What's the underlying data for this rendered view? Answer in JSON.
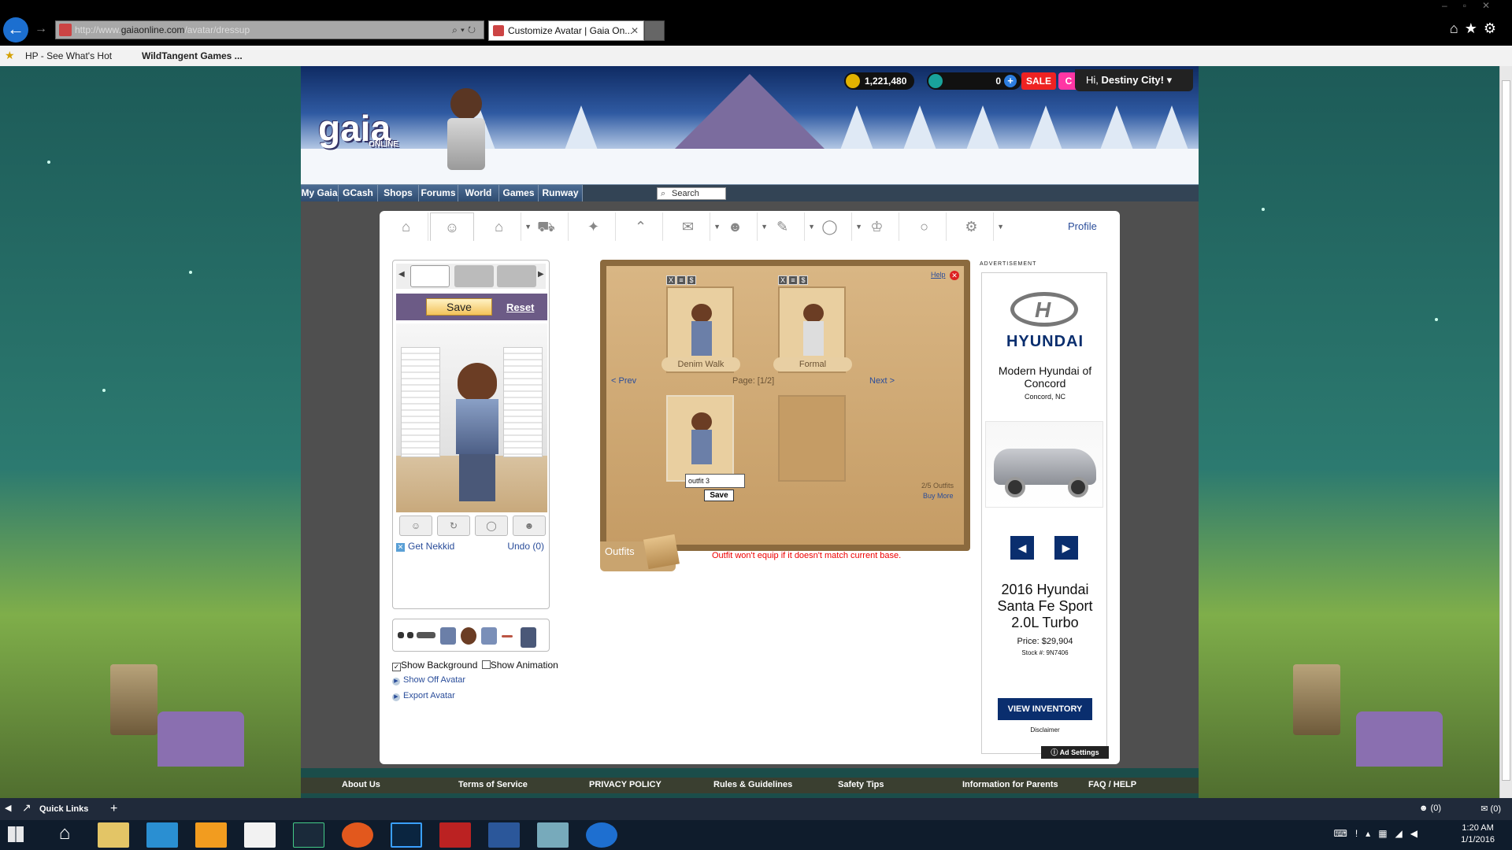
{
  "browser": {
    "url_prefix": "http://www.",
    "url_host": "gaiaonline.com",
    "url_path": "/avatar/dressup",
    "tab_title": "Customize Avatar | Gaia On...",
    "favorites": [
      {
        "label": "HP - See What's Hot"
      },
      {
        "label": "WildTangent Games ..."
      }
    ]
  },
  "site": {
    "logo": "gaia",
    "logo_sub": "ONLINE",
    "gold": "1,221,480",
    "gcash": "0",
    "sale_label": "SALE",
    "sale_c": "C",
    "greeting_prefix": "Hi, ",
    "username": "Destiny City!",
    "menu": [
      "My Gaia",
      "GCash",
      "Shops",
      "Forums",
      "World",
      "Games",
      "Runway"
    ],
    "search_label": "Search",
    "profile_link": "Profile"
  },
  "dressup": {
    "save_label": "Save",
    "reset_label": "Reset",
    "get_nekkid": "Get Nekkid",
    "undo": "Undo (0)",
    "show_background": "Show Background",
    "show_background_checked": true,
    "show_animation": "Show Animation",
    "show_animation_checked": false,
    "show_off_avatar": "Show Off Avatar",
    "export_avatar": "Export Avatar"
  },
  "outfits": {
    "help": "Help",
    "slot_icons": [
      "X",
      "≡",
      "$"
    ],
    "saved": [
      {
        "name": "Denim Walk"
      },
      {
        "name": "Formal"
      }
    ],
    "prev": "< Prev",
    "page": "Page: [1/2]",
    "next": "Next >",
    "new_outfit_name": "outfit 3",
    "save_label": "Save",
    "count": "2/5 Outfits",
    "buy_more": "Buy More",
    "tab_label": "Outfits",
    "warning": "Outfit won't equip if it doesn't match current base."
  },
  "ad": {
    "label": "ADVERTISEMENT",
    "brand": "HYUNDAI",
    "dealer": "Modern Hyundai of Concord",
    "city": "Concord, NC",
    "prev": "◀",
    "next": "▶",
    "model": "2016 Hyundai Santa Fe Sport 2.0L Turbo",
    "price": "Price: $29,904",
    "stock": "Stock #: 9N7406",
    "cta": "VIEW INVENTORY",
    "disclaimer": "Disclaimer",
    "settings": "Ad Settings"
  },
  "footer": [
    "About Us",
    "Terms of Service",
    "PRIVACY POLICY",
    "Rules & Guidelines",
    "Safety Tips",
    "Information for Parents",
    "FAQ / HELP"
  ],
  "linksbar": {
    "quick_links": "Quick Links",
    "friends_count": "(0)",
    "mail_count": "(0)"
  },
  "taskbar": {
    "time": "1:20 AM",
    "date": "1/1/2016"
  }
}
